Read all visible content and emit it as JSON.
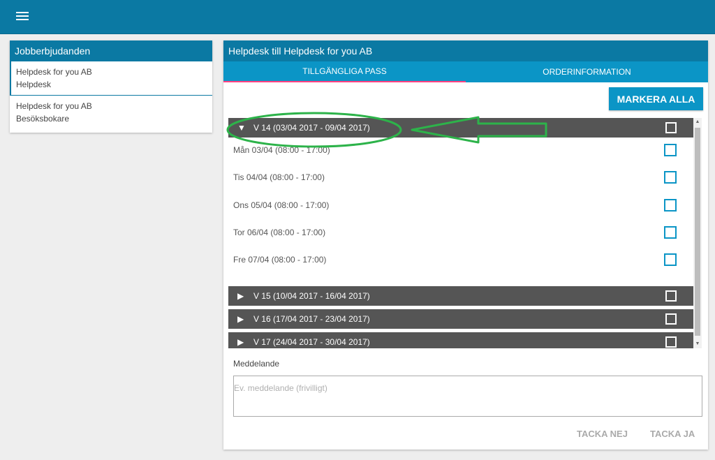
{
  "header": {
    "menu_icon": "hamburger-icon"
  },
  "job_offers": {
    "title": "Jobberbjudanden",
    "items": [
      {
        "company": "Helpdesk for you AB",
        "role": "Helpdesk"
      },
      {
        "company": "Helpdesk for you AB",
        "role": "Besöksbokare"
      }
    ]
  },
  "detail": {
    "title": "Helpdesk till Helpdesk for you AB",
    "tabs": [
      "TILLGÄNGLIGA PASS",
      "ORDERINFORMATION"
    ],
    "mark_all": "MARKERA ALLA",
    "weeks": [
      {
        "label": "V 14 (03/04 2017 - 09/04 2017)",
        "expanded": true,
        "days": [
          "Mån 03/04 (08:00 - 17:00)",
          "Tis 04/04 (08:00 - 17:00)",
          "Ons 05/04 (08:00 - 17:00)",
          "Tor 06/04 (08:00 - 17:00)",
          "Fre 07/04 (08:00 - 17:00)"
        ]
      },
      {
        "label": "V 15 (10/04 2017 - 16/04 2017)",
        "expanded": false
      },
      {
        "label": "V 16 (17/04 2017 - 23/04 2017)",
        "expanded": false
      },
      {
        "label": "V 17 (24/04 2017 - 30/04 2017)",
        "expanded": false
      }
    ],
    "message_label": "Meddelande",
    "message_placeholder": "Ev. meddelande (frivilligt)",
    "decline": "TACKA NEJ",
    "accept": "TACKA JA"
  },
  "colors": {
    "primary": "#0b79a3",
    "tab_bar": "#0b95c6",
    "tab_indicator": "#ff4081",
    "week_bg": "#555555",
    "annotation": "#2db34a"
  }
}
